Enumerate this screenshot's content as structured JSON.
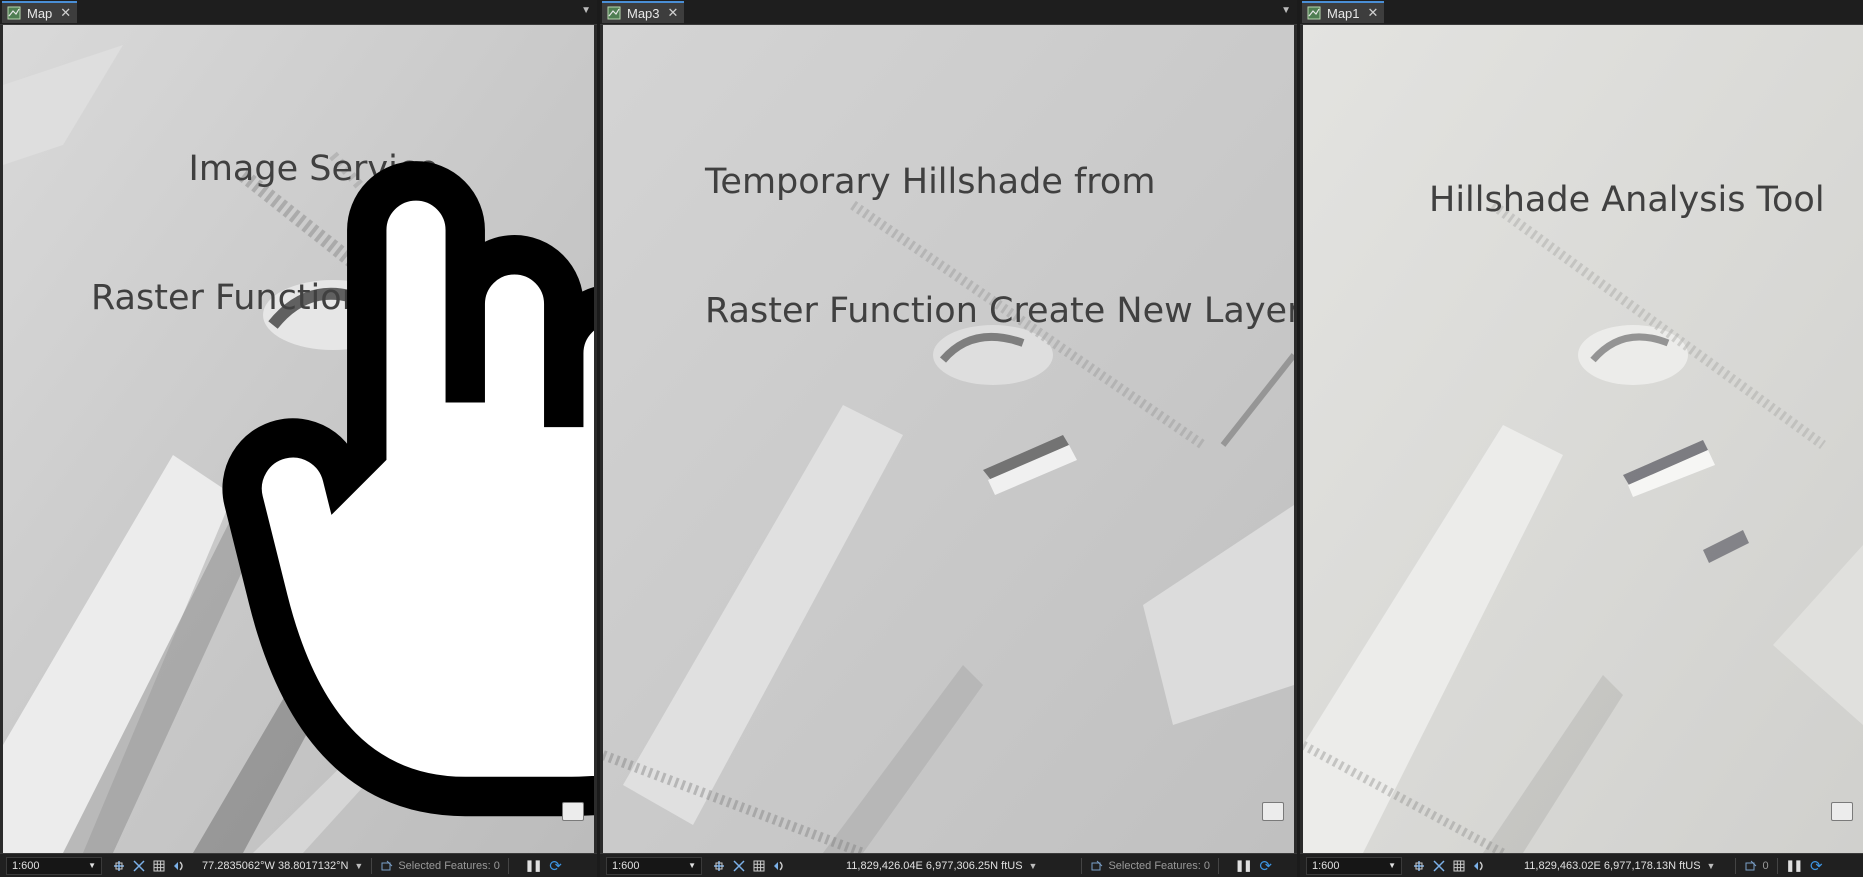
{
  "panes": [
    {
      "tab_label": "Map",
      "title_lines": [
        "Image Service",
        "Raster Function Hillshade"
      ],
      "scale": "1:600",
      "coords": "77.2835062°W 38.8017132°N",
      "selected_features": "Selected Features: 0"
    },
    {
      "tab_label": "Map3",
      "title_lines": [
        "Temporary Hillshade from",
        "Raster Function Create New Layer"
      ],
      "scale": "1:600",
      "coords": "11,829,426.04E 6,977,306.25N ftUS",
      "selected_features": "Selected Features: 0"
    },
    {
      "tab_label": "Map1",
      "title_lines": [
        "Hillshade Analysis Tool"
      ],
      "scale": "1:600",
      "coords": "11,829,463.02E 6,977,178.13N ftUS",
      "selected_features": "0"
    }
  ],
  "icons": {
    "tab": "map-icon",
    "close": "close-icon",
    "dropdown": "chevron-down-icon",
    "legend": "legend-icon",
    "pause": "pause-icon",
    "refresh": "refresh-icon"
  },
  "colors": {
    "accent": "#4a8fd6",
    "refresh": "#3d93e0",
    "map_light": "#d8d8d8",
    "map_pane3": "#e2e2df"
  }
}
